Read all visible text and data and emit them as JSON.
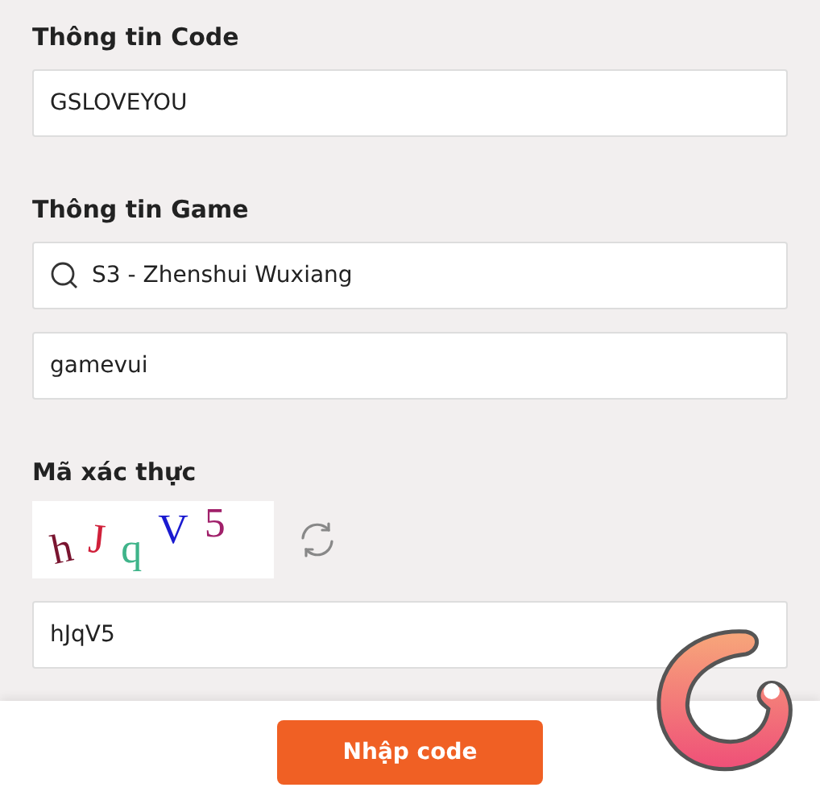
{
  "code_section": {
    "heading": "Thông tin Code",
    "value": "GSLOVEYOU"
  },
  "game_section": {
    "heading": "Thông tin Game",
    "server_value": "S3 - Zhenshui Wuxiang",
    "account_value": "gamevui"
  },
  "captcha_section": {
    "heading": "Mã xác thực",
    "captcha": [
      {
        "char": "h",
        "color": "#7a1530"
      },
      {
        "char": "J",
        "color": "#d0203a"
      },
      {
        "char": "q",
        "color": "#3fb48a"
      },
      {
        "char": "V",
        "color": "#1a1ad0"
      },
      {
        "char": "5",
        "color": "#a0206a"
      }
    ],
    "value": "hJqV5"
  },
  "submit_button": "Nhập code"
}
